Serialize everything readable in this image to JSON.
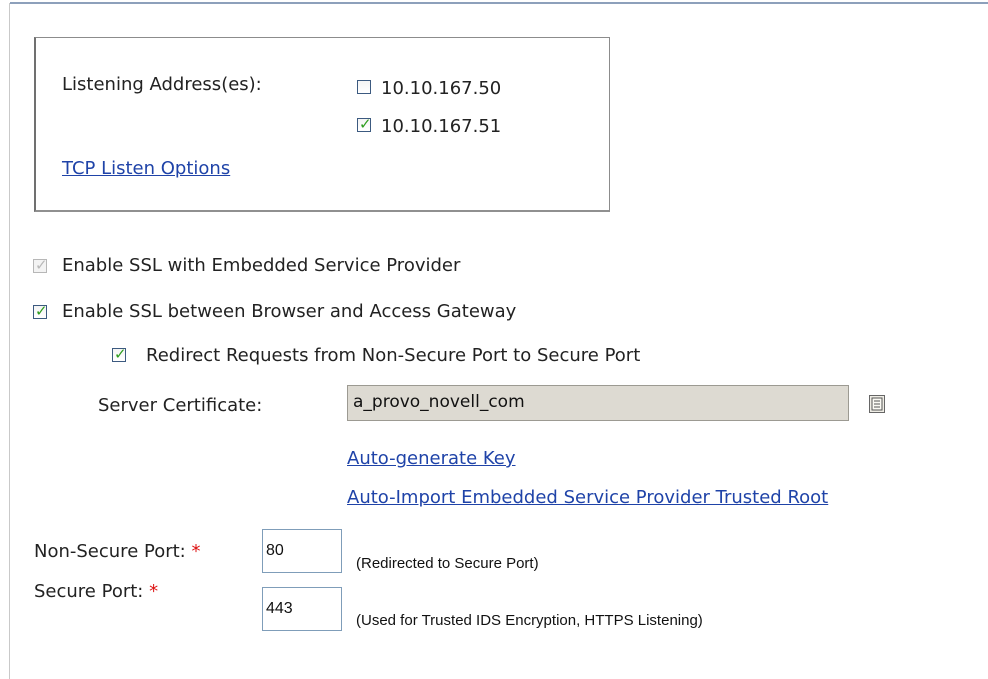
{
  "listening": {
    "label": "Listening Address(es):",
    "addresses": [
      {
        "ip": "10.10.167.50",
        "checked": false
      },
      {
        "ip": "10.10.167.51",
        "checked": true
      }
    ],
    "tcp_options_link": "TCP Listen Options"
  },
  "ssl": {
    "embedded_label": "Enable SSL with Embedded Service Provider",
    "embedded_checked": true,
    "browser_gateway_label": "Enable SSL between Browser and Access Gateway",
    "browser_gateway_checked": true,
    "redirect_label": "Redirect Requests from Non-Secure Port to Secure Port",
    "redirect_checked": true
  },
  "certificate": {
    "label": "Server Certificate:",
    "value": "a_provo_novell_com",
    "autogen_link": "Auto-generate Key",
    "autoimport_link": "Auto-Import Embedded Service Provider Trusted Root"
  },
  "ports": {
    "non_secure_label": "Non-Secure Port:",
    "non_secure_value": "80",
    "non_secure_note": "(Redirected to Secure Port)",
    "secure_label": "Secure Port:",
    "secure_value": "443",
    "secure_note": "(Used for Trusted IDS Encryption, HTTPS Listening)",
    "required_marker": "*"
  },
  "colors": {
    "link": "#1f43a8",
    "check": "#2f9e1f",
    "required": "#dd1111"
  }
}
